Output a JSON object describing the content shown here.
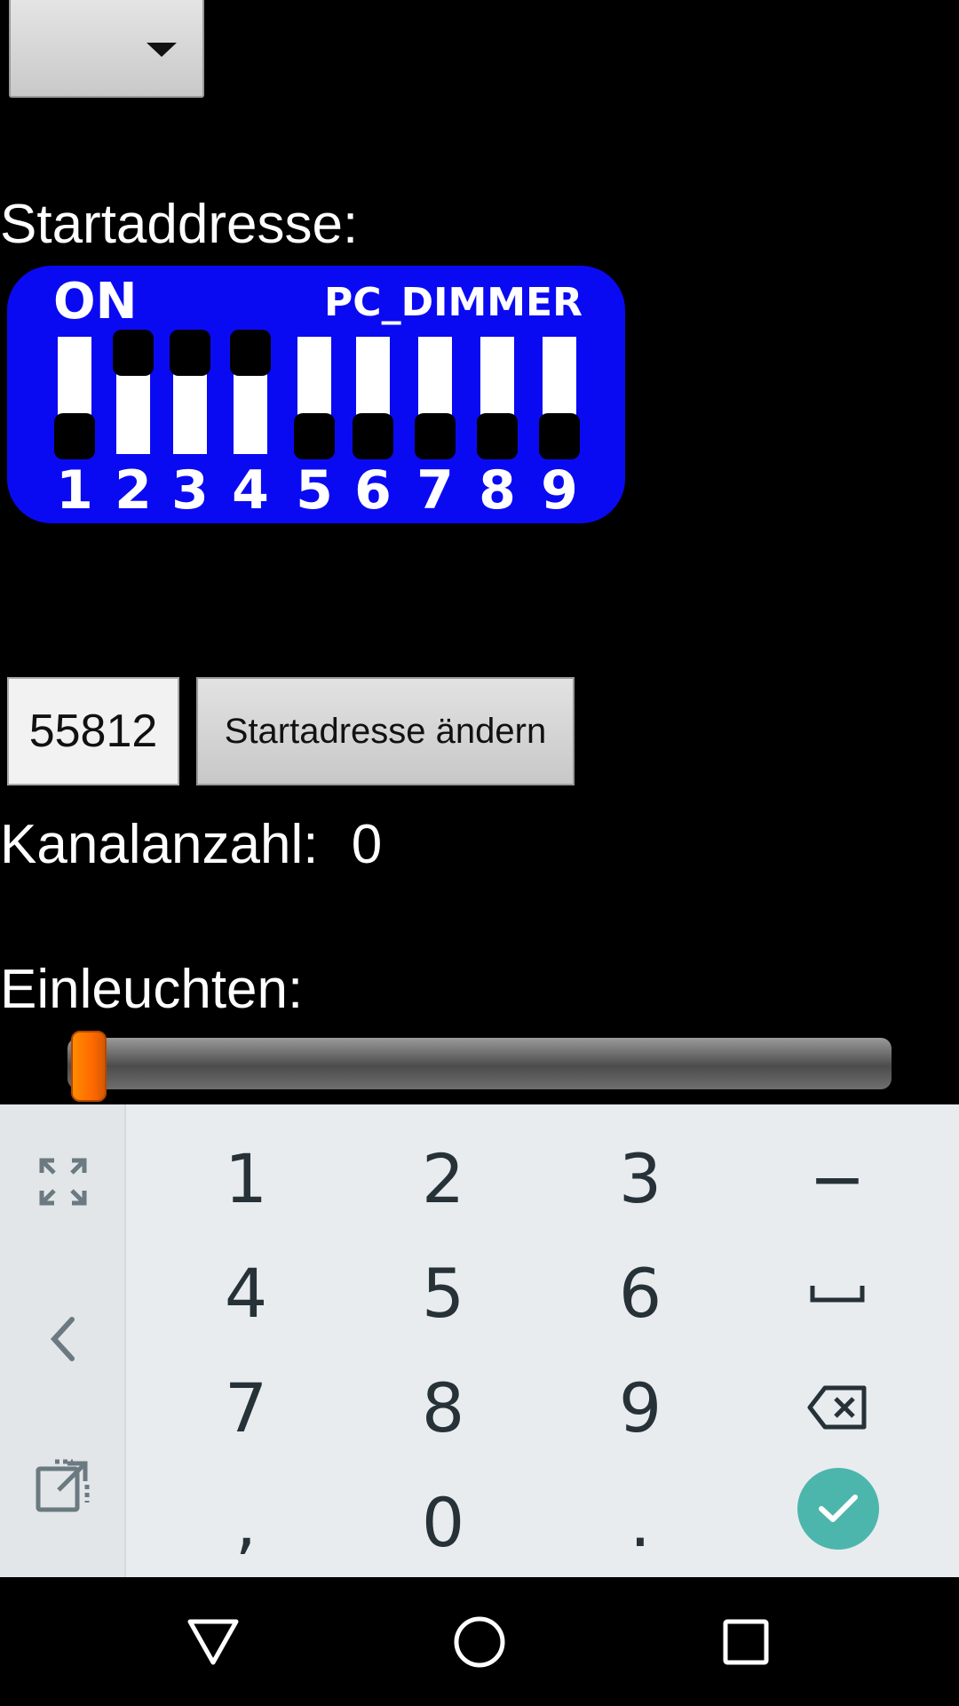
{
  "spinner": {
    "icon": "caret-down-icon"
  },
  "start_address": {
    "label": "Startaddresse:"
  },
  "dip_switch": {
    "on_label": "ON",
    "brand_label": "PC_DIMMER",
    "switches": [
      {
        "number": "1",
        "state": "off"
      },
      {
        "number": "2",
        "state": "on"
      },
      {
        "number": "3",
        "state": "on"
      },
      {
        "number": "4",
        "state": "on"
      },
      {
        "number": "5",
        "state": "off"
      },
      {
        "number": "6",
        "state": "off"
      },
      {
        "number": "7",
        "state": "off"
      },
      {
        "number": "8",
        "state": "off"
      },
      {
        "number": "9",
        "state": "off"
      }
    ]
  },
  "address_input": {
    "value": "55812"
  },
  "change_button": {
    "label": "Startadresse ändern"
  },
  "channel_count": {
    "label": "Kanalanzahl:",
    "value": "0"
  },
  "dimming": {
    "label": "Einleuchten:",
    "slider_value_fraction": 0
  },
  "keyboard": {
    "side_keys": [
      "fullscreen-icon",
      "arrow-left-icon",
      "popout-icon"
    ],
    "rows": [
      [
        "1",
        "2",
        "3",
        "−"
      ],
      [
        "4",
        "5",
        "6",
        "␣"
      ],
      [
        "7",
        "8",
        "9",
        "backspace"
      ],
      [
        ",",
        "0",
        ".",
        "done"
      ]
    ],
    "accent_color": "#4db6ac"
  },
  "nav_bar": {
    "buttons": [
      "back-icon",
      "home-icon",
      "recents-icon"
    ]
  }
}
